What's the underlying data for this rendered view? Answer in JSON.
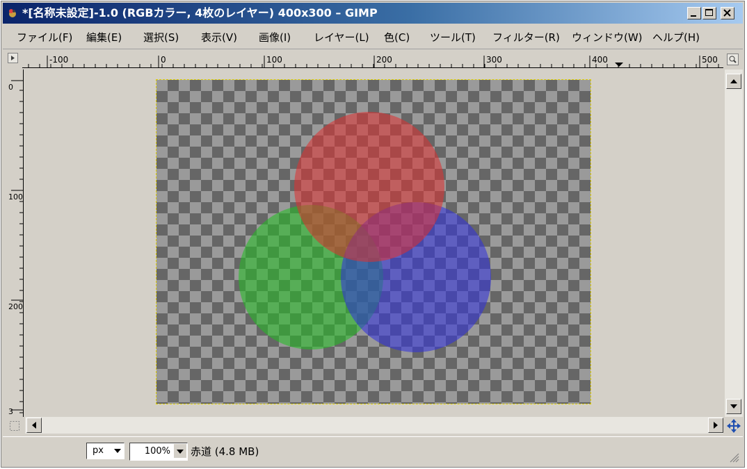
{
  "window": {
    "title": "*[名称未設定]-1.0 (RGBカラー, 4枚のレイヤー) 400x300 – GIMP"
  },
  "menu": [
    "ファイル(F)",
    "編集(E)",
    "選択(S)",
    "表示(V)",
    "画像(I)",
    "レイヤー(L)",
    "色(C)",
    "ツール(T)",
    "フィルター(R)",
    "ウィンドウ(W)",
    "ヘルプ(H)"
  ],
  "rulers": {
    "horizontal_labels": [
      "-100",
      "0",
      "100",
      "200",
      "300",
      "400",
      "500"
    ],
    "vertical_labels": [
      "0",
      "100",
      "200",
      "3"
    ]
  },
  "canvas": {
    "circles": [
      {
        "name": "red",
        "color": "#e03030"
      },
      {
        "name": "green",
        "color": "#20c020"
      },
      {
        "name": "blue",
        "color": "#3030e0"
      }
    ]
  },
  "statusbar": {
    "unit": "px",
    "zoom": "100%",
    "status": "赤道 (4.8 MB)"
  },
  "icons": [
    "gimp-app-icon",
    "minimize-icon",
    "maximize-icon",
    "close-icon",
    "ruler-menu-icon",
    "zoom-toggle-icon",
    "quick-mask-icon",
    "navigate-icon",
    "scroll-up-icon",
    "scroll-down-icon",
    "scroll-left-icon",
    "scroll-right-icon",
    "resize-grip-icon"
  ]
}
